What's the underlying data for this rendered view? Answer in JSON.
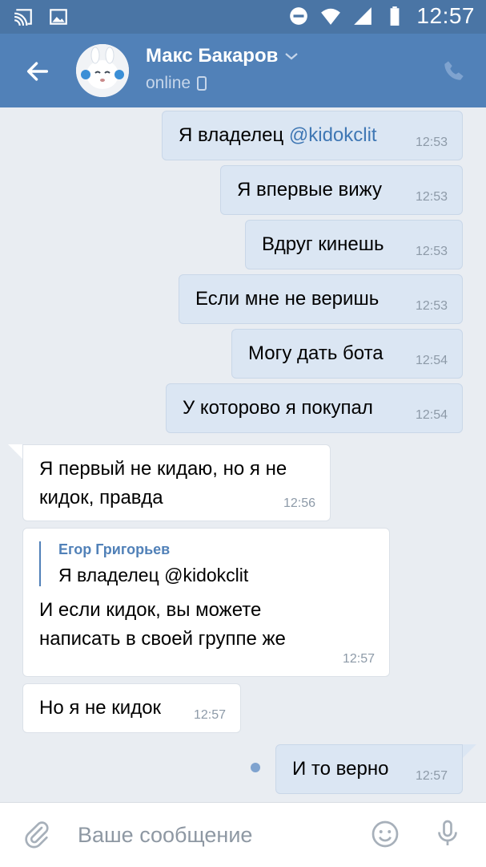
{
  "status_bar": {
    "time": "12:57"
  },
  "header": {
    "contact_name": "Макс Бакаров",
    "status": "online"
  },
  "messages": [
    {
      "direction": "out",
      "text_before": "Я владелец ",
      "mention": "@kidokclit",
      "time": "12:53"
    },
    {
      "direction": "out",
      "text": "Я впервые вижу",
      "time": "12:53"
    },
    {
      "direction": "out",
      "text": "Вдруг кинешь",
      "time": "12:53"
    },
    {
      "direction": "out",
      "text": "Если мне не веришь",
      "time": "12:53"
    },
    {
      "direction": "out",
      "text": "Могу дать бота",
      "time": "12:54"
    },
    {
      "direction": "out",
      "text": "У которово я покупал",
      "time": "12:54"
    },
    {
      "direction": "in",
      "lines": [
        "Я первый не кидаю, но я не",
        "кидок, правда"
      ],
      "time": "12:56"
    },
    {
      "direction": "in",
      "quote": {
        "author": "Егор Григорьев",
        "text": "Я владелец @kidokclit"
      },
      "lines": [
        "И если кидок, вы можете",
        "написать в своей группе же"
      ],
      "time": "12:57"
    },
    {
      "direction": "in",
      "text": "Но я не кидок",
      "time": "12:57"
    },
    {
      "direction": "out",
      "text": "И то верно",
      "time": "12:57",
      "unread": true
    }
  ],
  "composer": {
    "placeholder": "Ваше сообщение"
  },
  "colors": {
    "header": "#5181b8",
    "status_bar": "#4a75a5",
    "outgoing_bubble": "#dbe6f3",
    "background": "#e9edf2"
  }
}
